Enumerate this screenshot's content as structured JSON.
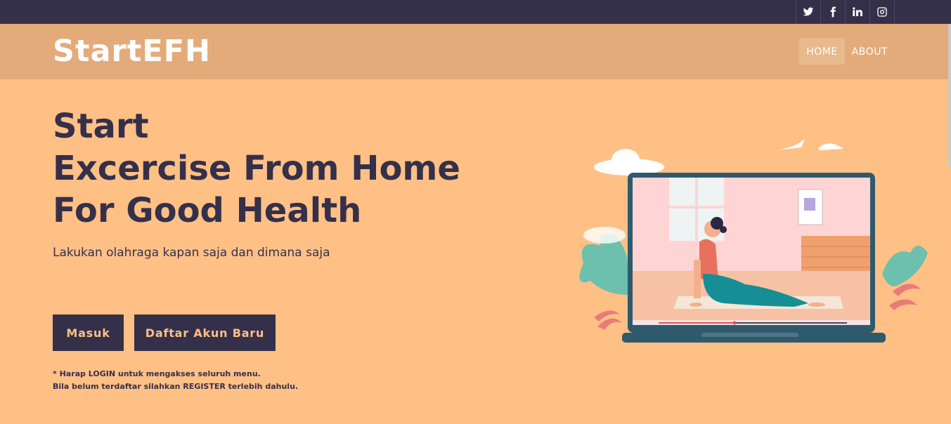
{
  "social": [
    "twitter-icon",
    "facebook-icon",
    "linkedin-icon",
    "instagram-icon"
  ],
  "brand": {
    "part1": "Start",
    "part2": "EFH"
  },
  "nav": {
    "home": "HOME",
    "about": "ABOUT"
  },
  "hero": {
    "line1": "Start",
    "line2": "Excercise From Home",
    "line3": "For Good Health",
    "subtitle": "Lakukan olahraga kapan saja dan dimana saja"
  },
  "buttons": {
    "login": "Masuk",
    "register": "Daftar Akun Baru"
  },
  "note": {
    "line1": "* Harap LOGIN untuk mengakses seluruh menu.",
    "line2": "Bila belum terdaftar silahkan REGISTER terlebih dahulu."
  },
  "colors": {
    "dark": "#35304a",
    "peach": "#ffc086",
    "nav": "#e3ab79"
  }
}
